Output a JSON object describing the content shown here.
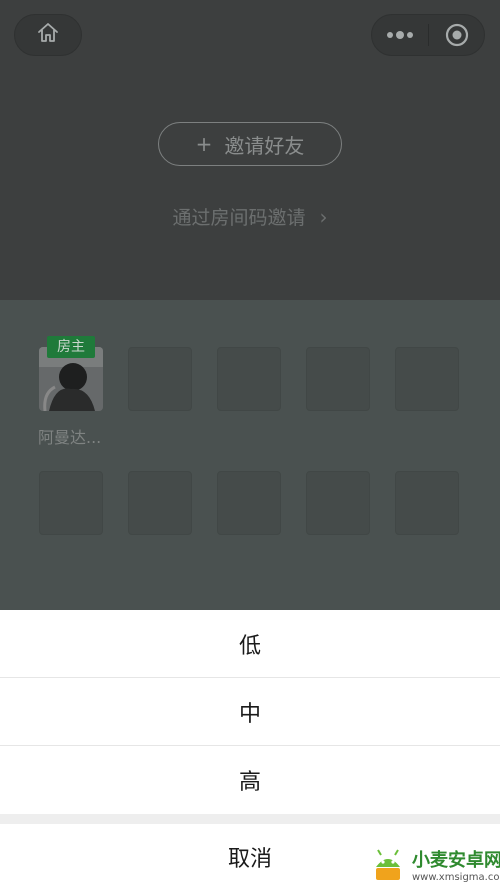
{
  "header": {
    "home_icon": "home-icon",
    "more_icon": "more-dots-icon",
    "close_icon": "target-close-icon"
  },
  "invite": {
    "plus": "+",
    "label": "邀请好友"
  },
  "room_code": {
    "label": "通过房间码邀请",
    "chevron": "›"
  },
  "seats": {
    "host_badge": "房主",
    "host_name": "阿曼达..."
  },
  "action_sheet": {
    "options": [
      "低",
      "中",
      "高"
    ],
    "cancel": "取消"
  },
  "watermark": {
    "title": "小麦安卓网",
    "url": "www.xmsigma.com"
  },
  "colors": {
    "badge": "#1f7a3a",
    "top_bg": "#3d3f3f",
    "seats_bg": "#4a5150"
  }
}
